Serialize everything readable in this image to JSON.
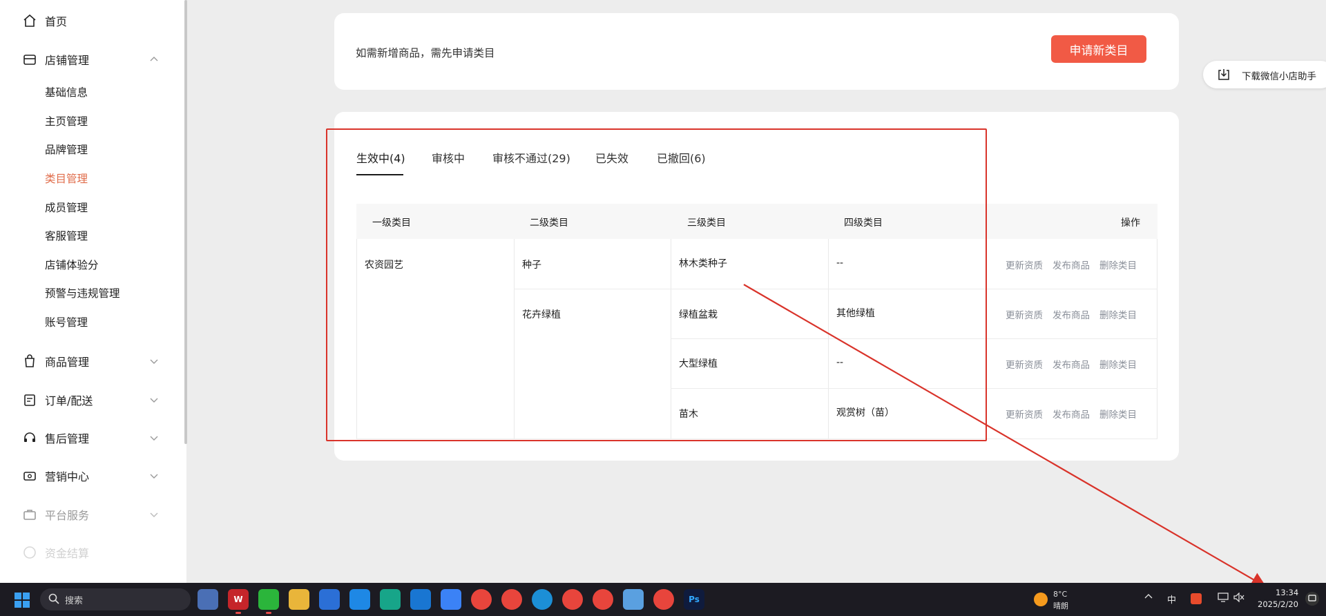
{
  "sidebar": {
    "home": "首页",
    "shop": {
      "label": "店铺管理",
      "items": [
        "基础信息",
        "主页管理",
        "品牌管理",
        "类目管理",
        "成员管理",
        "客服管理",
        "店铺体验分",
        "预警与违规管理",
        "账号管理"
      ],
      "active_index": 3
    },
    "groups": [
      "商品管理",
      "订单/配送",
      "售后管理",
      "营销中心",
      "平台服务",
      "资金结算"
    ]
  },
  "top_card": {
    "notice": "如需新增商品，需先申请类目",
    "apply_button": "申请新类目"
  },
  "download_helper": "下载微信小店助手",
  "tabs": [
    "生效中(4)",
    "审核中",
    "审核不通过(29)",
    "已失效",
    "已撤回(6)"
  ],
  "active_tab": 0,
  "table": {
    "headers": [
      "一级类目",
      "二级类目",
      "三级类目",
      "四级类目",
      "操作"
    ],
    "level1": "农资园艺",
    "level2": [
      "种子",
      "花卉绿植"
    ],
    "rows": [
      {
        "level3": "林木类种子",
        "level4": "--"
      },
      {
        "level3": "绿植盆栽",
        "level4": "其他绿植"
      },
      {
        "level3": "大型绿植",
        "level4": "--"
      },
      {
        "level3": "苗木",
        "level4": "观赏树（苗）"
      }
    ],
    "actions": [
      "更新资质",
      "发布商品",
      "删除类目"
    ]
  },
  "taskbar": {
    "search_placeholder": "搜索",
    "weather_temp": "8°C",
    "weather_condition": "晴朗",
    "ime": "中",
    "time": "13:34",
    "date": "2025/2/20",
    "ps_label": "Ps"
  },
  "colors": {
    "accent": "#f15a45",
    "active_nav": "#e06c4a",
    "annotation": "#d9332a"
  }
}
